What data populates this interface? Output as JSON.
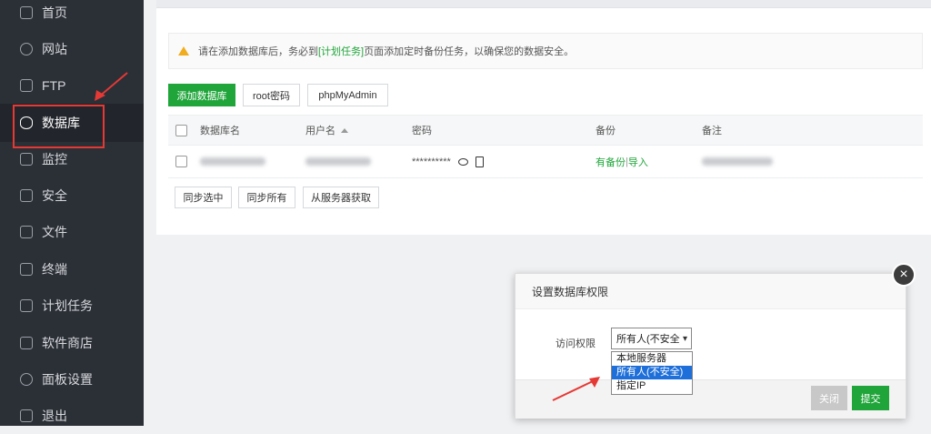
{
  "sidebar": {
    "items": [
      {
        "label": "首页",
        "icon": "home-icon"
      },
      {
        "label": "网站",
        "icon": "globe-icon"
      },
      {
        "label": "FTP",
        "icon": "ftp-icon"
      },
      {
        "label": "数据库",
        "icon": "database-icon",
        "active": true
      },
      {
        "label": "监控",
        "icon": "monitor-icon"
      },
      {
        "label": "安全",
        "icon": "shield-icon"
      },
      {
        "label": "文件",
        "icon": "folder-icon"
      },
      {
        "label": "终端",
        "icon": "terminal-icon"
      },
      {
        "label": "计划任务",
        "icon": "calendar-icon"
      },
      {
        "label": "软件商店",
        "icon": "apps-icon"
      },
      {
        "label": "面板设置",
        "icon": "gear-icon"
      },
      {
        "label": "退出",
        "icon": "logout-icon"
      }
    ]
  },
  "notice": {
    "pre": "请在添加数据库后，务必到",
    "link": "[计划任务]",
    "post": "页面添加定时备份任务，以确保您的数据安全。",
    "icon": "warning-icon"
  },
  "toolbar": {
    "add_db": "添加数据库",
    "root_pwd": "root密码",
    "phpmyadmin": "phpMyAdmin"
  },
  "table": {
    "headers": {
      "name": "数据库名",
      "user": "用户名",
      "password": "密码",
      "backup": "备份",
      "remark": "备注"
    },
    "row": {
      "password": "**********",
      "backup_has": "有备份",
      "sep": " | ",
      "import": "导入"
    }
  },
  "bottom_buttons": {
    "sync_selected": "同步选中",
    "sync_all": "同步所有",
    "fetch_server": "从服务器获取"
  },
  "dialog": {
    "title": "设置数据库权限",
    "access_label": "访问权限",
    "select_value": "所有人(不安全)",
    "options": [
      "本地服务器",
      "所有人(不安全)",
      "指定IP"
    ],
    "close_btn": "关闭",
    "submit_btn": "提交",
    "close_glyph": "×"
  },
  "colors": {
    "accent": "#20a53a",
    "sidebar": "#2b2f36",
    "highlight": "#e53935",
    "select_blue": "#1e6fd9"
  }
}
